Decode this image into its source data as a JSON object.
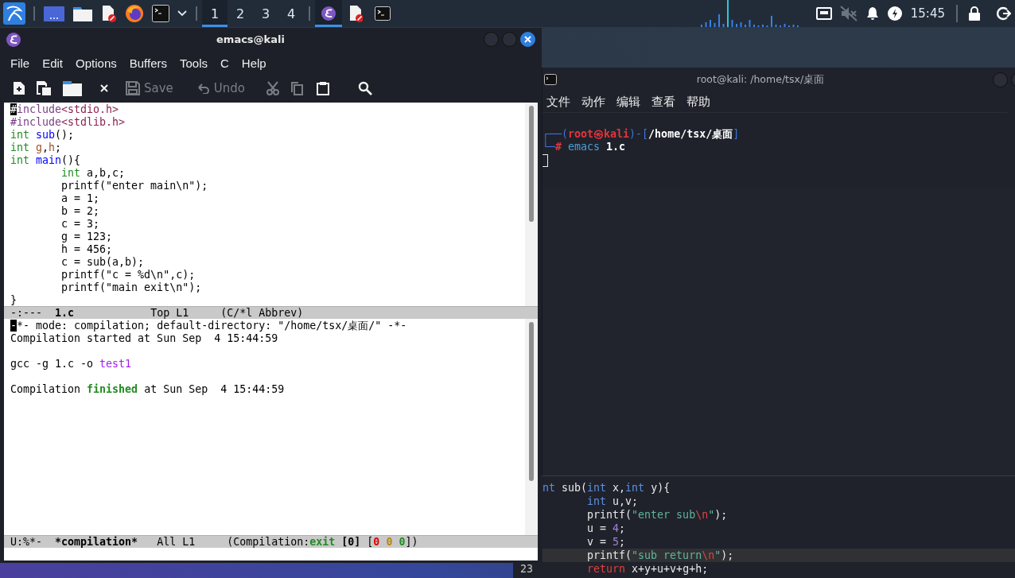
{
  "taskbar": {
    "workspaces": [
      {
        "label": "1",
        "selected": true
      },
      {
        "label": "2",
        "selected": false
      },
      {
        "label": "3",
        "selected": false
      },
      {
        "label": "4",
        "selected": false
      }
    ],
    "tasks": [
      {
        "kind": "emacs",
        "selected": true
      },
      {
        "kind": "document",
        "selected": false
      },
      {
        "kind": "terminal",
        "selected": false
      }
    ],
    "clock": "15:45"
  },
  "emacs": {
    "title": "emacs@kali",
    "menu": [
      "File",
      "Edit",
      "Options",
      "Buffers",
      "Tools",
      "C",
      "Help"
    ],
    "toolbar": [
      {
        "kind": "new",
        "disabled": false
      },
      {
        "kind": "open",
        "disabled": false
      },
      {
        "kind": "folder",
        "disabled": false
      },
      {
        "kind": "close",
        "disabled": false
      },
      {
        "kind": "save",
        "label": "Save",
        "disabled": true
      },
      {
        "kind": "undo",
        "label": "Undo",
        "disabled": true
      },
      {
        "kind": "cut",
        "disabled": true
      },
      {
        "kind": "copy",
        "disabled": true
      },
      {
        "kind": "paste",
        "disabled": false
      },
      {
        "kind": "search",
        "disabled": false
      }
    ],
    "source_buffer": {
      "lines": [
        {
          "kind": "text",
          "segments": [
            {
              "text": "#",
              "kind": "cursor"
            },
            {
              "text": "include",
              "kind": "preproc"
            },
            {
              "text": "<stdio.h>",
              "kind": "string"
            }
          ]
        },
        {
          "kind": "text",
          "segments": [
            {
              "text": "#include",
              "kind": "preproc"
            },
            {
              "text": "<stdlib.h>",
              "kind": "string"
            }
          ]
        },
        {
          "kind": "text",
          "segments": [
            {
              "text": "int ",
              "kind": "type"
            },
            {
              "text": "sub",
              "kind": "func"
            },
            {
              "text": "();",
              "kind": "plain"
            }
          ]
        },
        {
          "kind": "text",
          "segments": [
            {
              "text": "int ",
              "kind": "type"
            },
            {
              "text": "g",
              "kind": "var"
            },
            {
              "text": ",",
              "kind": "plain"
            },
            {
              "text": "h",
              "kind": "var"
            },
            {
              "text": ";",
              "kind": "plain"
            }
          ]
        },
        {
          "kind": "text",
          "segments": [
            {
              "text": "int ",
              "kind": "type"
            },
            {
              "text": "main",
              "kind": "func"
            },
            {
              "text": "(){",
              "kind": "plain"
            }
          ]
        },
        {
          "kind": "text",
          "segments": [
            {
              "text": "        int",
              "kind": "type"
            },
            {
              "text": " a,b,c;",
              "kind": "plain"
            }
          ]
        },
        {
          "kind": "text",
          "segments": [
            {
              "text": "        printf(\"enter main\\n\");",
              "kind": "plain"
            }
          ]
        },
        {
          "kind": "text",
          "segments": [
            {
              "text": "        a = 1;",
              "kind": "plain"
            }
          ]
        },
        {
          "kind": "text",
          "segments": [
            {
              "text": "        b = 2;",
              "kind": "plain"
            }
          ]
        },
        {
          "kind": "text",
          "segments": [
            {
              "text": "        c = 3;",
              "kind": "plain"
            }
          ]
        },
        {
          "kind": "text",
          "segments": [
            {
              "text": "        g = 123;",
              "kind": "plain"
            }
          ]
        },
        {
          "kind": "text",
          "segments": [
            {
              "text": "        h = 456;",
              "kind": "plain"
            }
          ]
        },
        {
          "kind": "text",
          "segments": [
            {
              "text": "        c = sub(a,b);",
              "kind": "plain"
            }
          ]
        },
        {
          "kind": "text",
          "segments": [
            {
              "text": "        printf(\"c = %d\\n\",c);",
              "kind": "plain"
            }
          ]
        },
        {
          "kind": "text",
          "segments": [
            {
              "text": "        printf(\"main exit\\n\");",
              "kind": "plain"
            }
          ]
        },
        {
          "kind": "text",
          "segments": [
            {
              "text": "}",
              "kind": "plain"
            }
          ]
        }
      ],
      "mode_line": [
        {
          "text": "-:---  ",
          "kind": "plain"
        },
        {
          "text": "1.c",
          "kind": "bold"
        },
        {
          "text": "            Top L1     (C/*l Abbrev)",
          "kind": "plain"
        }
      ]
    },
    "compilation_buffer": {
      "lines": [
        {
          "kind": "text",
          "segments": [
            {
              "text": "-",
              "kind": "cursor"
            },
            {
              "text": "*- mode: compilation; default-directory: \"/home/tsx/桌面/\" -*-",
              "kind": "plain"
            }
          ]
        },
        {
          "kind": "text",
          "segments": [
            {
              "text": "Compilation started at Sun Sep  4 15:44:59",
              "kind": "plain"
            }
          ]
        },
        {
          "kind": "blank"
        },
        {
          "kind": "text",
          "segments": [
            {
              "text": "gcc -g 1.c -o ",
              "kind": "plain"
            },
            {
              "text": "test1",
              "kind": "target"
            }
          ]
        },
        {
          "kind": "blank"
        },
        {
          "kind": "text",
          "segments": [
            {
              "text": "Compilation ",
              "kind": "plain"
            },
            {
              "text": "finished",
              "kind": "success"
            },
            {
              "text": " at Sun Sep  4 15:44:59",
              "kind": "plain"
            }
          ]
        }
      ],
      "mode_line": [
        {
          "text": "U:%*-  ",
          "kind": "plain"
        },
        {
          "text": "*compilation*",
          "kind": "bold"
        },
        {
          "text": "   All L1     (Compilation:",
          "kind": "plain"
        },
        {
          "text": "exit",
          "kind": "success"
        },
        {
          "text": " [0]",
          "kind": "bold"
        },
        {
          "text": " [",
          "kind": "plain"
        },
        {
          "text": "0",
          "kind": "error"
        },
        {
          "text": " 0",
          "kind": "warning"
        },
        {
          "text": " 0",
          "kind": "info"
        },
        {
          "text": "])",
          "kind": "plain"
        }
      ]
    }
  },
  "terminal": {
    "title": "root@kali: /home/tsx/桌面",
    "menu": [
      "文件",
      "动作",
      "编辑",
      "查看",
      "帮助"
    ],
    "lines": [
      {
        "kind": "text",
        "segments": [
          {
            "text": "┌──(",
            "kind": "frame"
          },
          {
            "text": "root㉿kali",
            "kind": "user"
          },
          {
            "text": ")-[",
            "kind": "frame"
          },
          {
            "text": "/home/tsx/桌面",
            "kind": "path"
          },
          {
            "text": "]",
            "kind": "frame"
          }
        ]
      },
      {
        "kind": "text",
        "segments": [
          {
            "text": "└─",
            "kind": "frame"
          },
          {
            "text": "#",
            "kind": "hash"
          },
          {
            "text": " emacs",
            "kind": "command"
          },
          {
            "text": " 1.c",
            "kind": "path"
          }
        ]
      },
      {
        "kind": "cursor"
      }
    ]
  },
  "editor": {
    "lines": [
      {
        "current": false,
        "segments": [
          {
            "text": "nt",
            "kind": "keyword"
          },
          {
            "text": " sub(",
            "kind": "code"
          },
          {
            "text": "int",
            "kind": "keyword"
          },
          {
            "text": " x,",
            "kind": "code"
          },
          {
            "text": "int",
            "kind": "keyword"
          },
          {
            "text": " y){",
            "kind": "code"
          }
        ]
      },
      {
        "current": false,
        "segments": [
          {
            "text": "       int",
            "kind": "keyword"
          },
          {
            "text": " u,v;",
            "kind": "code"
          }
        ]
      },
      {
        "current": false,
        "segments": [
          {
            "text": "       printf(",
            "kind": "code"
          },
          {
            "text": "\"enter sub",
            "kind": "str"
          },
          {
            "text": "\\n",
            "kind": "escape"
          },
          {
            "text": "\"",
            "kind": "str"
          },
          {
            "text": ");",
            "kind": "code"
          }
        ]
      },
      {
        "current": false,
        "segments": [
          {
            "text": "       u = ",
            "kind": "code"
          },
          {
            "text": "4",
            "kind": "number"
          },
          {
            "text": ";",
            "kind": "code"
          }
        ]
      },
      {
        "current": false,
        "segments": [
          {
            "text": "       v = ",
            "kind": "code"
          },
          {
            "text": "5",
            "kind": "number"
          },
          {
            "text": ";",
            "kind": "code"
          }
        ]
      },
      {
        "current": true,
        "segments": [
          {
            "text": "       printf(",
            "kind": "code"
          },
          {
            "text": "\"sub return",
            "kind": "str"
          },
          {
            "text": "\\n",
            "kind": "escape"
          },
          {
            "text": "\"",
            "kind": "str"
          },
          {
            "text": ");",
            "kind": "code"
          }
        ]
      },
      {
        "current": false,
        "number": "23",
        "segments": [
          {
            "text": "       return",
            "kind": "control"
          },
          {
            "text": " x+y+u+v+g+h;",
            "kind": "code"
          }
        ]
      }
    ]
  }
}
